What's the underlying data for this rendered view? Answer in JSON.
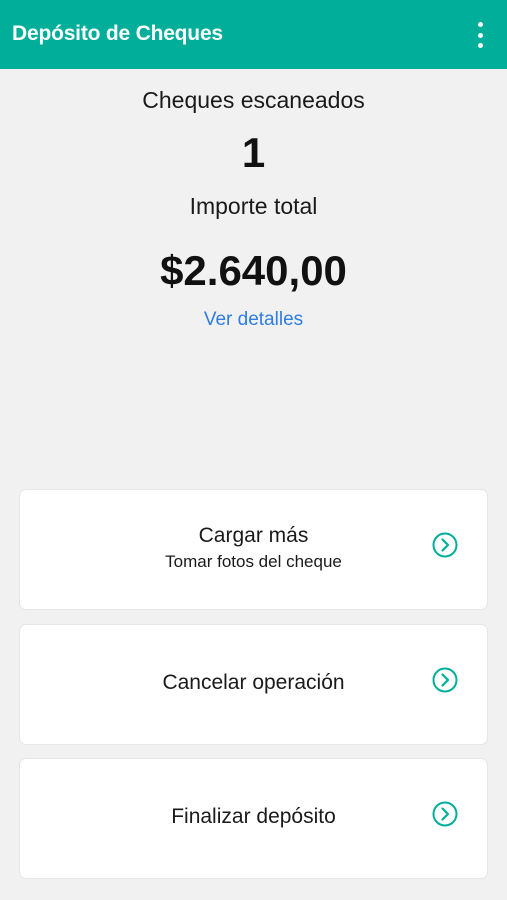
{
  "header": {
    "title": "Depósito de Cheques",
    "menu_icon": "more-vertical-icon",
    "background": "#00ae9a"
  },
  "summary": {
    "scanned_label": "Cheques escaneados",
    "scanned_count": "1",
    "total_label": "Importe total",
    "total_amount": "$2.640,00",
    "details_link": "Ver detalles"
  },
  "actions": [
    {
      "title": "Cargar más",
      "subtitle": "Tomar fotos del cheque",
      "icon": "chevron-right-circle-icon"
    },
    {
      "title": "Cancelar operación",
      "icon": "chevron-right-circle-icon"
    },
    {
      "title": "Finalizar depósito",
      "icon": "chevron-right-circle-icon"
    }
  ],
  "colors": {
    "accent": "#00ae9a",
    "link": "#2f7de1",
    "background": "#f1f1f1"
  }
}
